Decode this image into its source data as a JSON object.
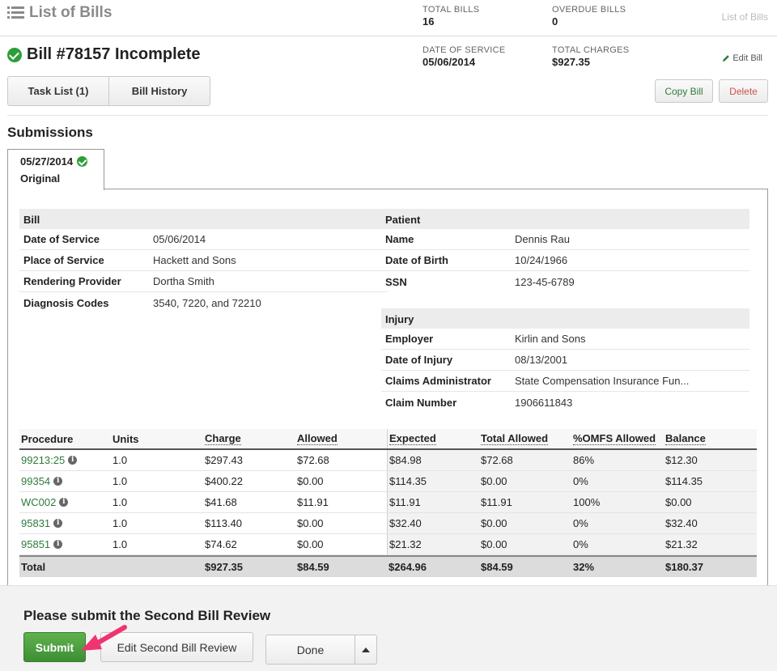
{
  "topbar": {
    "title": "List of Bills",
    "total_bills_label": "TOTAL BILLS",
    "total_bills_value": "16",
    "overdue_bills_label": "OVERDUE BILLS",
    "overdue_bills_value": "0",
    "crumb": "List of Bills"
  },
  "bill": {
    "title": "Bill #78157 Incomplete",
    "date_of_service_label": "DATE OF SERVICE",
    "date_of_service_value": "05/06/2014",
    "total_charges_label": "TOTAL CHARGES",
    "total_charges_value": "$927.35",
    "edit_label": "Edit Bill"
  },
  "buttons": {
    "task_list": "Task List (1)",
    "bill_history": "Bill History",
    "copy_bill": "Copy Bill",
    "delete": "Delete"
  },
  "submissions": {
    "title": "Submissions",
    "tab_date": "05/27/2014",
    "tab_type": "Original"
  },
  "bill_info": {
    "header": "Bill",
    "rows": [
      {
        "k": "Date of Service",
        "v": "05/06/2014"
      },
      {
        "k": "Place of Service",
        "v": "Hackett and Sons"
      },
      {
        "k": "Rendering Provider",
        "v": "Dortha Smith"
      },
      {
        "k": "Diagnosis Codes",
        "v": "3540, 7220, and 72210"
      }
    ]
  },
  "patient_info": {
    "header": "Patient",
    "rows": [
      {
        "k": "Name",
        "v": "Dennis Rau"
      },
      {
        "k": "Date of Birth",
        "v": "10/24/1966"
      },
      {
        "k": "SSN",
        "v": "123-45-6789"
      }
    ]
  },
  "injury_info": {
    "header": "Injury",
    "rows": [
      {
        "k": "Employer",
        "v": "Kirlin and Sons"
      },
      {
        "k": "Date of Injury",
        "v": "08/13/2001"
      },
      {
        "k": "Claims Administrator",
        "v": "State Compensation Insurance Fun..."
      },
      {
        "k": "Claim Number",
        "v": "1906611843"
      }
    ]
  },
  "procedures": {
    "columns": [
      "Procedure",
      "Units",
      "Charge",
      "Allowed",
      "Expected",
      "Total Allowed",
      "%OMFS Allowed",
      "Balance"
    ],
    "rows": [
      [
        "99213:25",
        "1.0",
        "$297.43",
        "$72.68",
        "$84.98",
        "$72.68",
        "86%",
        "$12.30"
      ],
      [
        "99354",
        "1.0",
        "$400.22",
        "$0.00",
        "$114.35",
        "$0.00",
        "0%",
        "$114.35"
      ],
      [
        "WC002",
        "1.0",
        "$41.68",
        "$11.91",
        "$11.91",
        "$11.91",
        "100%",
        "$0.00"
      ],
      [
        "95831",
        "1.0",
        "$113.40",
        "$0.00",
        "$32.40",
        "$0.00",
        "0%",
        "$32.40"
      ],
      [
        "95851",
        "1.0",
        "$74.62",
        "$0.00",
        "$21.32",
        "$0.00",
        "0%",
        "$21.32"
      ]
    ],
    "total": [
      "Total",
      "",
      "$927.35",
      "$84.59",
      "$264.96",
      "$84.59",
      "32%",
      "$180.37"
    ]
  },
  "action": {
    "message": "Please submit the Second Bill Review",
    "submit": "Submit",
    "edit_review": "Edit Second Bill Review",
    "done": "Done"
  },
  "colors": {
    "accent_green": "#2e9e3a",
    "link_green": "#2f7a3b",
    "danger_red": "#c9524c",
    "annotation_pink": "#f0346f"
  }
}
